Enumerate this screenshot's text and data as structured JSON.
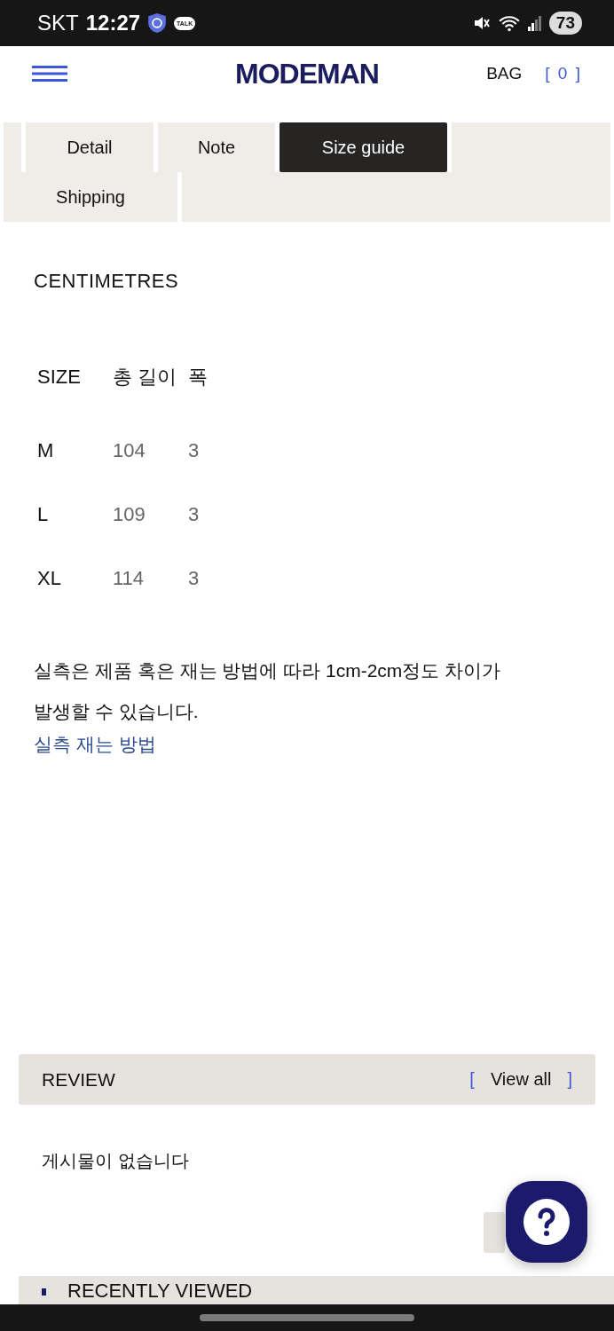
{
  "status_bar": {
    "carrier": "SKT",
    "time": "12:27",
    "chat_badge": "TALK",
    "battery": "73"
  },
  "header": {
    "logo": "MODEMAN",
    "bag_label": "BAG",
    "bag_count": "[ 0 ]"
  },
  "tabs": [
    {
      "label": "Detail",
      "selected": false
    },
    {
      "label": "Note",
      "selected": false
    },
    {
      "label": "Size guide",
      "selected": true
    },
    {
      "label": "Shipping",
      "selected": false
    }
  ],
  "size_guide": {
    "unit": "CENTIMETRES",
    "columns": [
      "SIZE",
      "총 길이",
      "폭"
    ],
    "rows": [
      [
        "M",
        "104",
        "3"
      ],
      [
        "L",
        "109",
        "3"
      ],
      [
        "XL",
        "114",
        "3"
      ]
    ],
    "note": "실측은 제품 혹은 재는 방법에 따라 1cm-2cm정도 차이가 발생할 수 있습니다.",
    "link": "실측 재는 방법"
  },
  "review": {
    "title": "REVIEW",
    "open_bracket": "[",
    "view_all": "View all",
    "close_bracket": "]",
    "empty": "게시물이 없습니다"
  },
  "recently_viewed": {
    "title": "RECENTLY VIEWED"
  }
}
